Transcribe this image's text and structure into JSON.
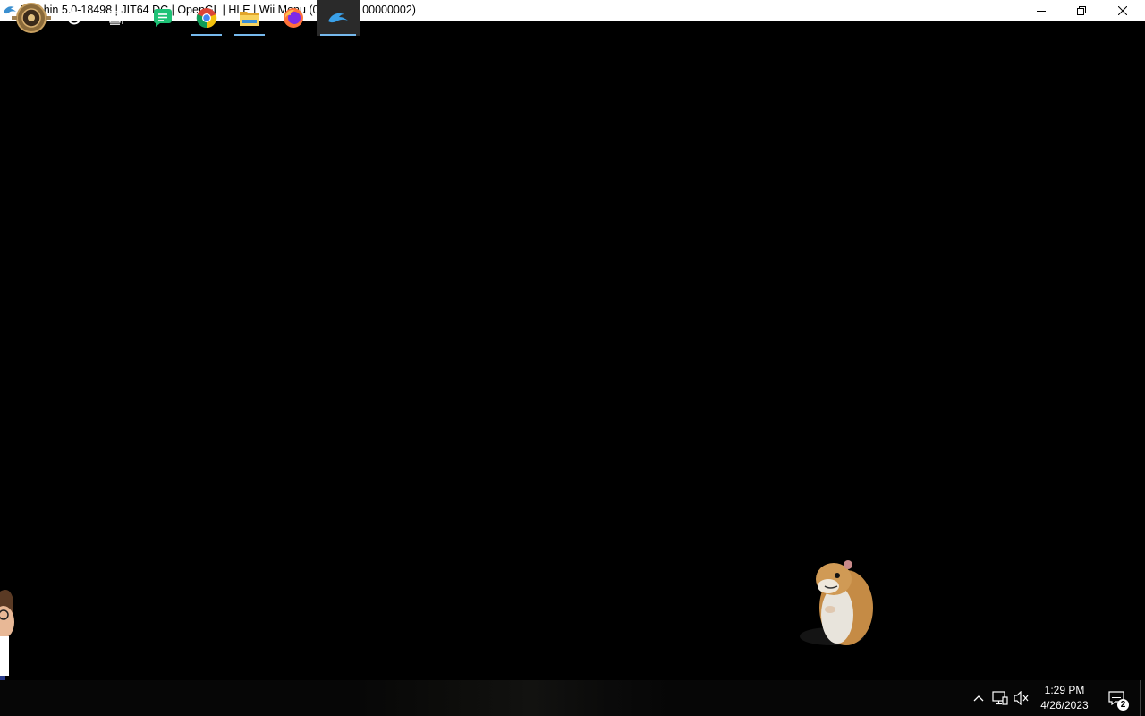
{
  "window": {
    "title": "Dolphin 5.0-18498 | JIT64 DC | OpenGL | HLE | Wii Menu (0000000100000002)",
    "app_icon": "dolphin-icon",
    "controls": [
      "minimize-icon",
      "restore-icon",
      "close-icon"
    ]
  },
  "taskbar": {
    "items": [
      {
        "name": "start",
        "icon": "start-orb-icon"
      },
      {
        "name": "search",
        "icon": "cortana-circle-icon"
      },
      {
        "name": "task-view",
        "icon": "task-view-icon"
      },
      {
        "name": "app-green",
        "icon": "chat-bubble-icon"
      },
      {
        "name": "chrome",
        "icon": "chrome-icon"
      },
      {
        "name": "file-explorer",
        "icon": "folder-icon"
      },
      {
        "name": "firefox",
        "icon": "firefox-icon"
      },
      {
        "name": "dolphin",
        "icon": "dolphin-icon"
      }
    ],
    "tray": {
      "time": "1:29 PM",
      "date": "4/26/2023",
      "notification_count": "2"
    }
  },
  "colors": {
    "accent": "#76b9ed",
    "viewport": "#000000",
    "taskbar": "#060606"
  }
}
